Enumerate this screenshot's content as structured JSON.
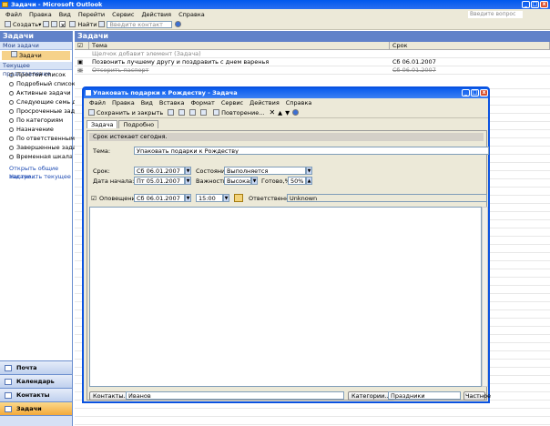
{
  "app": {
    "title": "Задачи - Microsoft Outlook"
  },
  "menu": [
    "Файл",
    "Правка",
    "Вид",
    "Перейти",
    "Сервис",
    "Действия",
    "Справка"
  ],
  "search_placeholder": "Введите вопрос",
  "toolbar": {
    "create": "Создать",
    "find": "Найти",
    "contact_placeholder": "Введите контакт"
  },
  "pane": {
    "title": "Задачи",
    "my_tasks": "Мои задачи",
    "tasks_item": "Задачи",
    "current_view": "Текущее представление",
    "views": [
      "Простой список",
      "Подробный список",
      "Активные задачи",
      "Следующие семь дней",
      "Просроченные задачи",
      "По категориям",
      "Назначение",
      "По ответственным",
      "Завершенные задачи",
      "Временная шкала для задач"
    ],
    "links": [
      "Открыть общие задачи...",
      "Настроить текущее представление..."
    ],
    "nav": [
      "Почта",
      "Календарь",
      "Контакты",
      "Задачи"
    ]
  },
  "grid": {
    "title": "Задачи",
    "col_subject": "Тема",
    "col_due": "Срок",
    "new_placeholder": "Щелчок добавит элемент (Задача)",
    "rows": [
      {
        "subject": "Позвонить лучшему другу и поздравить с днем варенья",
        "due": "Сб 06.01.2007"
      },
      {
        "subject": "Отсорить паспорт",
        "due": "Сб 06.01.2007"
      }
    ]
  },
  "dialog": {
    "title": "Упаковать подарки к Рождеству - Задача",
    "menu": [
      "Файл",
      "Правка",
      "Вид",
      "Вставка",
      "Формат",
      "Сервис",
      "Действия",
      "Справка"
    ],
    "save_close": "Сохранить и закрыть",
    "recurrence": "Повторение...",
    "tabs": [
      "Задача",
      "Подробно"
    ],
    "info": "Срок истекает сегодня.",
    "subject_label": "Тема:",
    "subject_value": "Упаковать подарки к Рождеству",
    "due_label": "Срок:",
    "due_value": "Сб 06.01.2007",
    "start_label": "Дата начала:",
    "start_value": "Пт 05.01.2007",
    "status_label": "Состояние:",
    "status_value": "Выполняется",
    "priority_label": "Важность:",
    "priority_value": "Высокая",
    "done_label": "Готово,%:",
    "done_value": "50%",
    "reminder_label": "Оповещение:",
    "reminder_date": "Сб 06.01.2007",
    "reminder_time": "15:00",
    "owner_label": "Ответственный:",
    "owner_value": "Unknown",
    "contacts_btn": "Контакты...",
    "contacts_value": "Иванов",
    "categories_btn": "Категории...",
    "categories_value": "Праздники",
    "private_label": "Частное"
  }
}
